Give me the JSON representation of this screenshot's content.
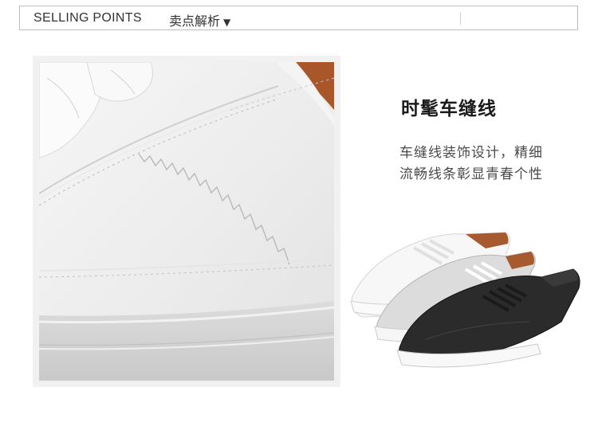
{
  "header": {
    "english_label": "SELLING POINTS",
    "chinese_label": "卖点解析",
    "arrow": "▼"
  },
  "feature": {
    "title": "时髦车缝线",
    "description_line1": "车缝线装饰设计，精细",
    "description_line2": "流畅线条彰显青春个性"
  },
  "images": {
    "closeup": "stitching-closeup-photo",
    "product": "three-sneakers-photo"
  }
}
